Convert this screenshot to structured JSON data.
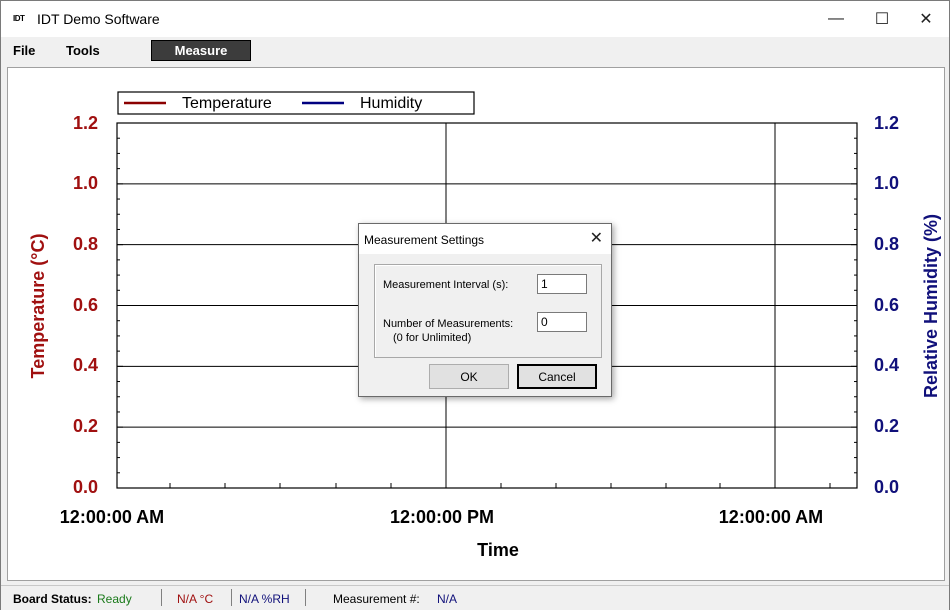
{
  "window": {
    "app_icon": "IDT",
    "title": "IDT Demo Software",
    "minimize_glyph": "—",
    "maximize_glyph": "☐",
    "close_glyph": "✕"
  },
  "menu": {
    "file": "File",
    "tools": "Tools",
    "measure": "Measure"
  },
  "chart": {
    "legend": {
      "temperature": "Temperature",
      "humidity": "Humidity"
    },
    "y_left_label": "Temperature (°C)",
    "y_right_label": "Relative Humidity (%)",
    "x_label": "Time",
    "y_ticks": [
      "0.0",
      "0.2",
      "0.4",
      "0.6",
      "0.8",
      "1.0",
      "1.2"
    ],
    "x_ticks": [
      "12:00:00 AM",
      "12:00:00 PM",
      "12:00:00 AM"
    ]
  },
  "chart_data": {
    "type": "line",
    "title": "",
    "xlabel": "Time",
    "ylabel": "Temperature (°C)",
    "y2label": "Relative Humidity (%)",
    "categories": [
      "12:00:00 AM",
      "12:00:00 PM",
      "12:00:00 AM"
    ],
    "ylim": [
      0,
      1.2
    ],
    "y2lim": [
      0,
      1.2
    ],
    "legend_position": "top-left",
    "grid": true,
    "series": [
      {
        "name": "Temperature",
        "color": "#8b0000",
        "values": []
      },
      {
        "name": "Humidity",
        "color": "#000080",
        "values": []
      }
    ]
  },
  "colors": {
    "temperature": "#a01010",
    "humidity": "#10107a"
  },
  "dialog": {
    "title": "Measurement Settings",
    "close_glyph": "✕",
    "interval_label": "Measurement Interval (s):",
    "interval_value": "1",
    "count_label": "Number of Measurements:",
    "count_sub_label": "(0 for Unlimited)",
    "count_value": "0",
    "ok": "OK",
    "cancel": "Cancel"
  },
  "status": {
    "board_label": "Board Status:",
    "board_value": "Ready",
    "temp_value": "N/A °C",
    "humidity_value": "N/A %RH",
    "measurement_label": "Measurement #:",
    "measurement_value": "N/A"
  }
}
